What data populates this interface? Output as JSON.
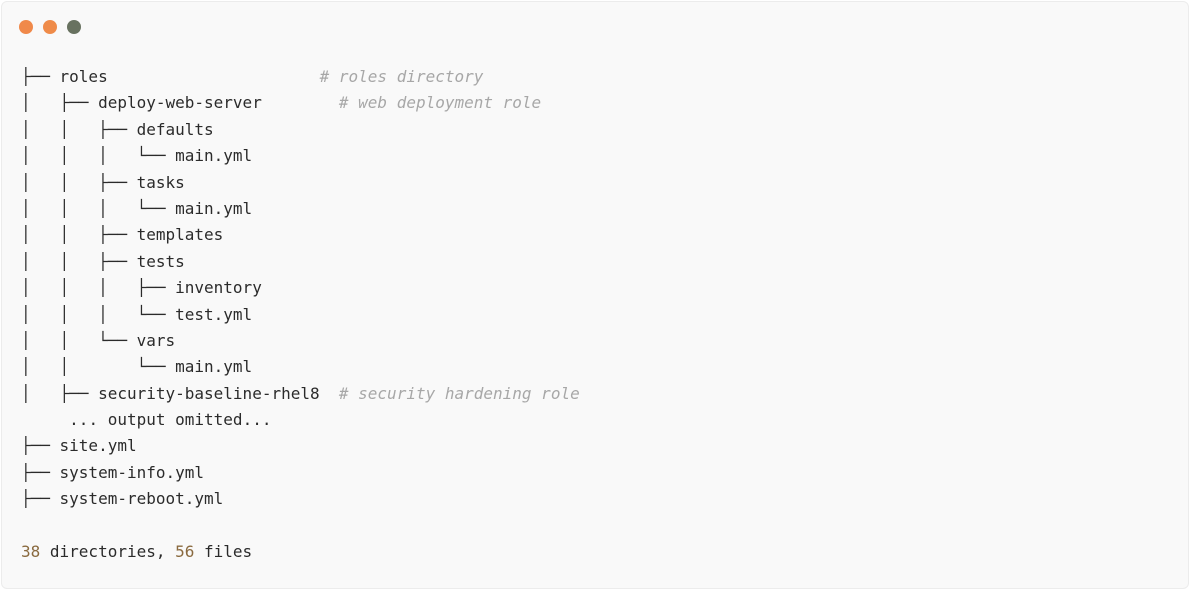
{
  "window": {
    "controls": [
      {
        "name": "close-dot",
        "color": "#f0894a"
      },
      {
        "name": "minimize-dot",
        "color": "#ef8b49"
      },
      {
        "name": "maximize-dot",
        "color": "#687260"
      }
    ]
  },
  "tree": [
    {
      "prefix": "├── ",
      "name": "roles",
      "pad": "                      ",
      "comment": "# roles directory"
    },
    {
      "prefix": "│   ├── ",
      "name": "deploy-web-server",
      "pad": "        ",
      "comment": "# web deployment role"
    },
    {
      "prefix": "│   │   ├── ",
      "name": "defaults"
    },
    {
      "prefix": "│   │   │   └── ",
      "name": "main.yml"
    },
    {
      "prefix": "│   │   ├── ",
      "name": "tasks"
    },
    {
      "prefix": "│   │   │   └── ",
      "name": "main.yml"
    },
    {
      "prefix": "│   │   ├── ",
      "name": "templates"
    },
    {
      "prefix": "│   │   ├── ",
      "name": "tests"
    },
    {
      "prefix": "│   │   │   ├── ",
      "name": "inventory"
    },
    {
      "prefix": "│   │   │   └── ",
      "name": "test.yml"
    },
    {
      "prefix": "│   │   └── ",
      "name": "vars"
    },
    {
      "prefix": "│   │       └── ",
      "name": "main.yml"
    },
    {
      "prefix": "│   ├── ",
      "name": "security-baseline-rhel8",
      "pad": "  ",
      "comment": "# security hardening role"
    },
    {
      "prefix": "     ",
      "name": "... output omitted..."
    },
    {
      "prefix": "├── ",
      "name": "site.yml"
    },
    {
      "prefix": "├── ",
      "name": "system-info.yml"
    },
    {
      "prefix": "├── ",
      "name": "system-reboot.yml"
    }
  ],
  "summary": {
    "dir_count": "38",
    "dir_label": " directories, ",
    "file_count": "56",
    "file_label": " files"
  }
}
